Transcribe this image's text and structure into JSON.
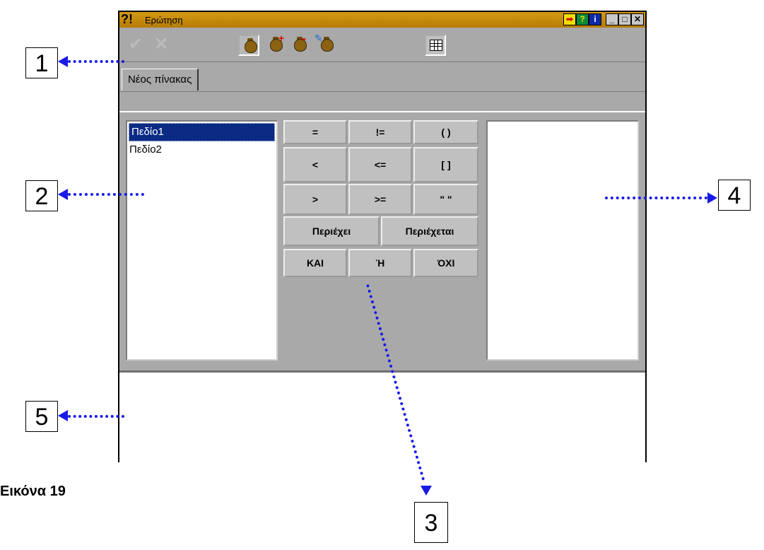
{
  "window": {
    "title_mark": "?!",
    "title": "Ερώτηση",
    "title_buttons": {
      "arrow": "➡",
      "help": "?",
      "info": "i",
      "minimize": "_",
      "maximize": "□",
      "close": "✕"
    }
  },
  "toolbar": {
    "items": [
      "check-icon",
      "cross-icon",
      "bag-icon",
      "bag-add-icon",
      "bag-remove-icon",
      "bag-edit-icon",
      "table-icon"
    ]
  },
  "tabs": [
    {
      "label": "Νέος πίνακας",
      "active": true
    }
  ],
  "fields": [
    {
      "label": "Πεδίο1",
      "selected": true
    },
    {
      "label": "Πεδίο2",
      "selected": false
    }
  ],
  "operators": {
    "eq": "=",
    "neq": "!=",
    "paren": "( )",
    "lt": "<",
    "lte": "<=",
    "brackets": "[ ]",
    "gt": ">",
    "gte": ">=",
    "quotes": "\" \"",
    "contains": "Περιέχει",
    "contained": "Περιέχεται",
    "and": "ΚΑΙ",
    "or": "Ή",
    "not": "ΌΧΙ"
  },
  "callouts": {
    "one": "1",
    "two": "2",
    "three": "3",
    "four": "4",
    "five": "5"
  },
  "caption": "Εικόνα 19",
  "colors": {
    "window_bg": "#a9a9a9",
    "titlebar": "#c08a0c",
    "selection": "#0b2a84",
    "callout_arrows": "#1a1ae6"
  }
}
